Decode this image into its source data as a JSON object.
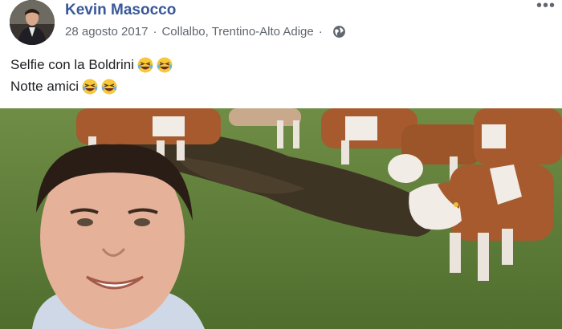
{
  "post": {
    "author": "Kevin Masocco",
    "date": "28 agosto 2017",
    "separator": "·",
    "location": "Collalbo, Trentino-Alto Adige",
    "privacy_icon": "globe-icon",
    "more_icon": "more-options-icon",
    "more_label": "•••",
    "text_lines": [
      "Selfie con la Boldrini",
      "Notte amici"
    ],
    "emoji": "laughing-emoji"
  },
  "colors": {
    "author": "#385898",
    "meta": "#616770",
    "grass": "#5c7a3a",
    "cow_brown": "#a65a2e"
  }
}
